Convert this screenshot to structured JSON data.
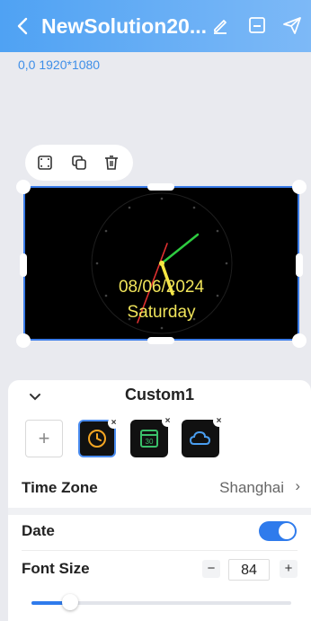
{
  "header": {
    "title": "NewSolution20...",
    "back_icon": "chevron-left-icon",
    "edit_icon": "pencil-icon",
    "save_icon": "save-icon",
    "publish_icon": "send-icon",
    "gradient_start": "#4fa2f3",
    "gradient_end": "#7db9f7"
  },
  "canvas": {
    "coords_text": "0,0 1920*1080",
    "toolbar": [
      "fullscreen-icon",
      "copy-icon",
      "delete-icon"
    ],
    "clock": {
      "date": "08/06/2024",
      "day": "Saturday"
    }
  },
  "panel": {
    "title": "Custom1",
    "collapse_icon": "chevron-down-icon",
    "add_label": "+",
    "tiles": [
      {
        "icon": "clock-icon",
        "selected": true,
        "remove": "×"
      },
      {
        "icon": "calendar-icon",
        "selected": false,
        "remove": "×"
      },
      {
        "icon": "cloud-icon",
        "selected": false,
        "remove": "×"
      }
    ],
    "timezone": {
      "label": "Time Zone",
      "value": "Shanghai",
      "chevron": "›"
    },
    "date": {
      "label": "Date",
      "enabled": true
    },
    "font_size": {
      "label": "Font Size",
      "minus": "−",
      "plus": "+",
      "value": "84",
      "slider_fraction": 0.15
    },
    "accent_color": "#2f7bec"
  }
}
